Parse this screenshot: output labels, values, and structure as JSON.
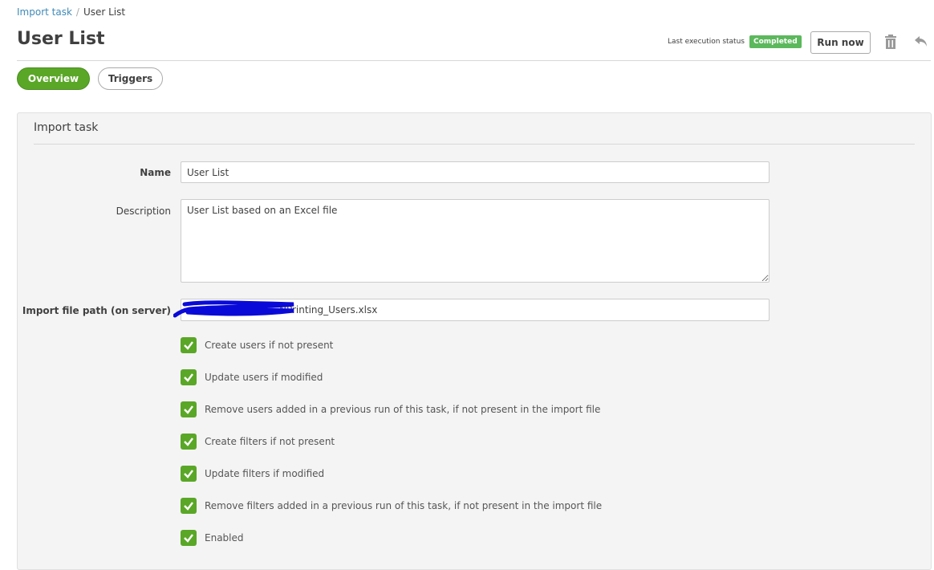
{
  "breadcrumb": {
    "parent": "Import task",
    "separator": "/",
    "current": "User List"
  },
  "header": {
    "title": "User List",
    "status_label": "Last execution status",
    "status_value": "Completed",
    "status_color": "#5cb85c",
    "run_now": "Run now",
    "delete_icon": "trash-icon",
    "back_icon": "undo-icon"
  },
  "tabs": [
    {
      "label": "Overview",
      "active": true
    },
    {
      "label": "Triggers",
      "active": false
    }
  ],
  "panel": {
    "title": "Import task",
    "name_label": "Name",
    "name_value": "User List",
    "description_label": "Description",
    "description_value": "User List based on an Excel file",
    "path_label": "Import file path (on server)",
    "path_value_visible": "NPrinting_Users.xlsx",
    "options": [
      {
        "label": "Create users if not present",
        "checked": true
      },
      {
        "label": "Update users if modified",
        "checked": true
      },
      {
        "label": "Remove users added in a previous run of this task, if not present in the import file",
        "checked": true
      },
      {
        "label": "Create filters if not present",
        "checked": true
      },
      {
        "label": "Update filters if modified",
        "checked": true
      },
      {
        "label": "Remove filters added in a previous run of this task, if not present in the import file",
        "checked": true
      },
      {
        "label": "Enabled",
        "checked": true
      }
    ]
  }
}
